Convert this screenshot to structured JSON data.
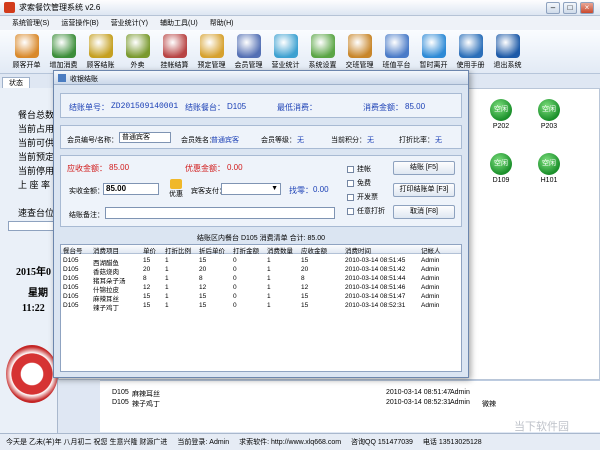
{
  "window": {
    "title": "求索餐饮管理系统 v2.6"
  },
  "menu": [
    "系统管理(S)",
    "运营操作(B)",
    "营业统计(Y)",
    "辅助工具(U)",
    "帮助(H)"
  ],
  "toolbar": [
    {
      "label": "顾客开单",
      "icon": "open-order-icon",
      "color": "#d9892b"
    },
    {
      "label": "增加消费",
      "icon": "add-consumption-icon",
      "color": "#3c8e3a"
    },
    {
      "label": "顾客结账",
      "icon": "checkout-icon",
      "color": "#c5a021"
    },
    {
      "label": "外卖",
      "icon": "takeout-icon",
      "color": "#7a9a2f"
    },
    {
      "label": "挂帐结算",
      "icon": "credit-icon",
      "color": "#b84444"
    },
    {
      "label": "预定管理",
      "icon": "reservation-icon",
      "color": "#d6a12e"
    },
    {
      "label": "会员管理",
      "icon": "member-icon",
      "color": "#5470b4"
    },
    {
      "label": "营业统计",
      "icon": "statistics-icon",
      "color": "#3da1d1"
    },
    {
      "label": "系统设置",
      "icon": "settings-icon",
      "color": "#5aa545"
    },
    {
      "label": "交班管理",
      "icon": "shift-icon",
      "color": "#c8862a"
    },
    {
      "label": "班值平台",
      "icon": "platform-icon",
      "color": "#4a7bc8"
    },
    {
      "label": "暂时离开",
      "icon": "away-icon",
      "color": "#2d8ad6"
    },
    {
      "label": "使用手册",
      "icon": "manual-icon",
      "color": "#2b6fb9"
    },
    {
      "label": "退出系统",
      "icon": "exit-icon",
      "color": "#1d5aa8"
    }
  ],
  "sidebar": {
    "tab": "状态",
    "lines": [
      "餐台总数",
      "当前占用",
      "当前可供",
      "当前预定",
      "当前停用",
      "上 座 率"
    ],
    "search_label": "速查台位",
    "date": "2015年0",
    "week": "星期",
    "time": "11:22"
  },
  "tables": [
    {
      "status": "空闲",
      "name": "P202"
    },
    {
      "status": "空闲",
      "name": "P203"
    },
    {
      "status": "空闲",
      "name": "D109"
    },
    {
      "status": "空闲",
      "name": "H101"
    }
  ],
  "dialog": {
    "title": "收银结账",
    "bill_no_label": "结账单号：",
    "bill_no": "ZD201509140001",
    "table_label": "结账餐台：",
    "table": "D105",
    "min_label": "最低消费：",
    "min_value": "",
    "amount_label": "消费金额：",
    "amount": "85.00",
    "member_no_label": "会员编号/名称：",
    "member_no": "普通宾客",
    "member_name_label": "会员姓名：",
    "member_name": "普通宾客",
    "member_level_label": "会员等级：",
    "member_level": "无",
    "points_label": "当前积分：",
    "points": "无",
    "discount_label": "打折比率：",
    "discount": "无",
    "receivable_label": "应收金额：",
    "receivable": "85.00",
    "favor_label": "优惠金额：",
    "favor": "0.00",
    "paid_label": "实收金额：",
    "paid": "85.00",
    "favor_button": "优惠",
    "guest_pay_label": "宾客支付：",
    "change_label": "找零：",
    "change": "0.00",
    "remark_label": "结账备注：",
    "options": [
      "挂帐",
      "免费",
      "开发票",
      "任意打折"
    ],
    "buttons": [
      "结账 [F5]",
      "打印结账单 [F3]",
      "取消 [F8]"
    ],
    "detail_caption": "结账区内餐台 D105 消费清单 合计: 85.00",
    "columns": [
      "餐台号",
      "消费项目",
      "单价",
      "打折比例",
      "折后单价",
      "打折金额",
      "消费数量",
      "应收金额",
      "消费时间",
      "记帐人"
    ],
    "rows": [
      [
        "D105",
        "西湖醋鱼",
        "15",
        "1",
        "15",
        "0",
        "1",
        "15",
        "2010-03-14 08:51:45",
        "Admin"
      ],
      [
        "D105",
        "香菇烧肉",
        "20",
        "1",
        "20",
        "0",
        "1",
        "20",
        "2010-03-14 08:51:42",
        "Admin"
      ],
      [
        "D105",
        "猪耳朵子汤",
        "8",
        "1",
        "8",
        "0",
        "1",
        "8",
        "2010-03-14 08:51:44",
        "Admin"
      ],
      [
        "D105",
        "什锦拉皮",
        "12",
        "1",
        "12",
        "0",
        "1",
        "12",
        "2010-03-14 08:51:46",
        "Admin"
      ],
      [
        "D105",
        "麻辣耳丝",
        "15",
        "1",
        "15",
        "0",
        "1",
        "15",
        "2010-03-14 08:51:47",
        "Admin"
      ],
      [
        "D105",
        "辣子鸡丁",
        "15",
        "1",
        "15",
        "0",
        "1",
        "15",
        "2010-03-14 08:52:31",
        "Admin"
      ]
    ]
  },
  "bg_rows": [
    [
      "D105",
      "麻辣耳丝",
      "2010-03-14 08:51:47",
      "Admin",
      ""
    ],
    [
      "D105",
      "辣子鸡丁",
      "2010-03-14 08:52:31",
      "Admin",
      "微辣"
    ]
  ],
  "status": [
    "今天是 乙未(羊)年 八月初二 祝您 生意兴隆 财源广进",
    "当前登录: Admin",
    "求索软件: http://www.xlq668.com",
    "咨询QQ 151477039",
    "电话 13513025128"
  ],
  "watermark": "当下软件园"
}
